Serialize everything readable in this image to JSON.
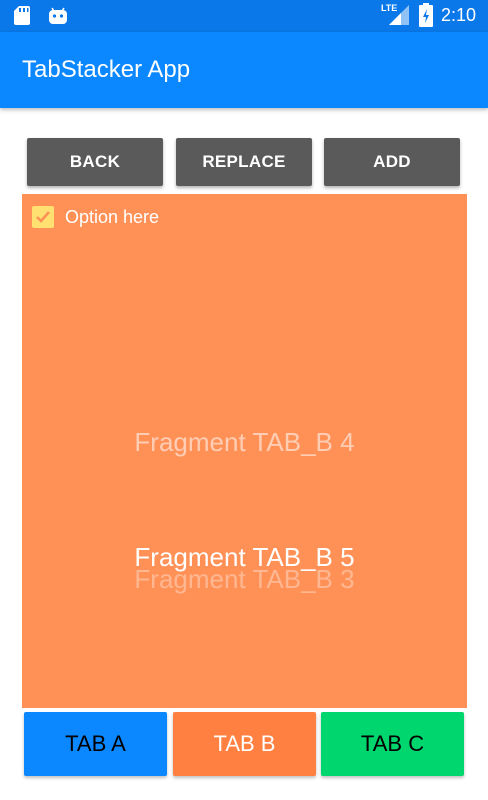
{
  "status_bar": {
    "time": "2:10",
    "network_label": "LTE",
    "icons": [
      "sd-card-icon",
      "android-icon",
      "lte-signal-icon",
      "battery-icon"
    ]
  },
  "app_bar": {
    "title": "TabStacker App"
  },
  "actions": {
    "back_label": "BACK",
    "replace_label": "REPLACE",
    "add_label": "ADD"
  },
  "fragment": {
    "checkbox_label": "Option here",
    "checkbox_checked": true,
    "labels": [
      "Fragment TAB_B 4",
      "Fragment TAB_B 5",
      "Fragment TAB_B 3"
    ],
    "background_color": "#ff9157"
  },
  "tabs": [
    {
      "label": "TAB A",
      "color": "#0b87ff"
    },
    {
      "label": "TAB B",
      "color": "#ff8040"
    },
    {
      "label": "TAB C",
      "color": "#00d66e"
    }
  ]
}
